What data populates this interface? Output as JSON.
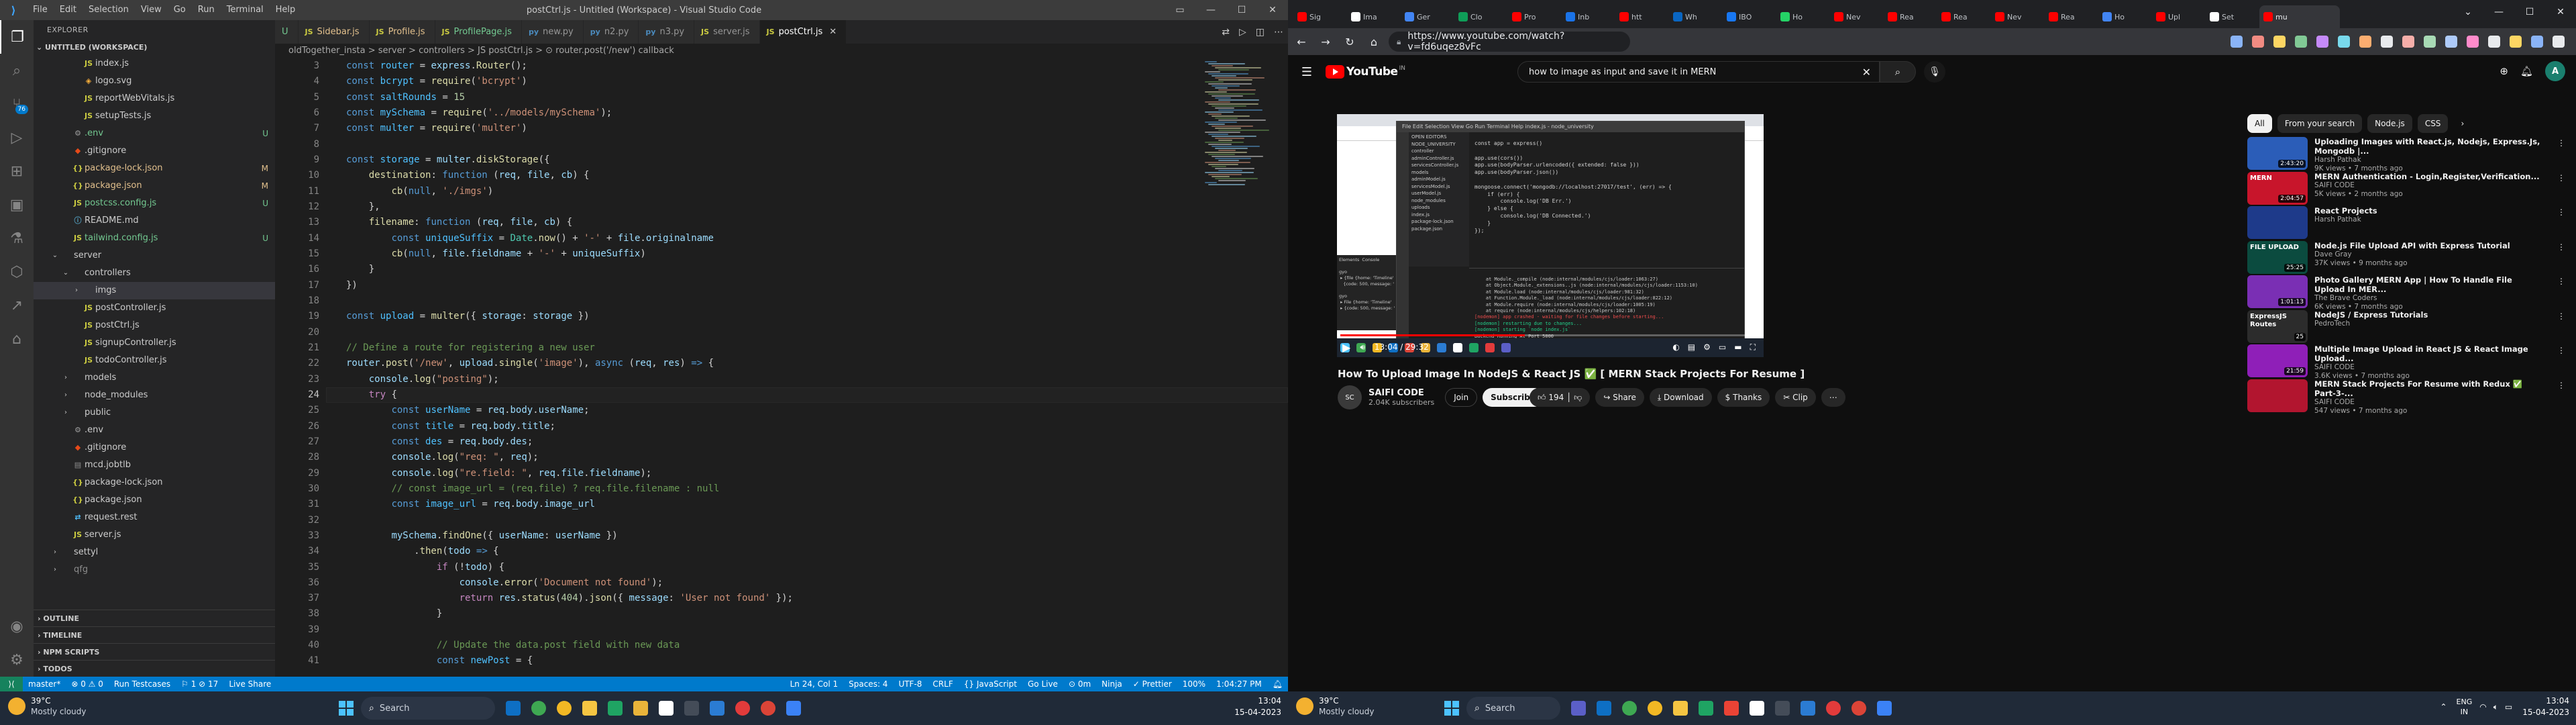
{
  "vscode": {
    "window_title": "postCtrl.js - Untitled (Workspace) - Visual Studio Code",
    "menu": [
      "File",
      "Edit",
      "Selection",
      "View",
      "Go",
      "Run",
      "Terminal",
      "Help"
    ],
    "explorer_title": "EXPLORER",
    "workspace": "UNTITLED (WORKSPACE)",
    "tree": [
      {
        "name": "index.js",
        "depth": 3,
        "kind": "js",
        "status": "",
        "cls": ""
      },
      {
        "name": "logo.svg",
        "depth": 3,
        "kind": "svg",
        "status": "",
        "cls": ""
      },
      {
        "name": "reportWebVitals.js",
        "depth": 3,
        "kind": "js",
        "status": "",
        "cls": ""
      },
      {
        "name": "setupTests.js",
        "depth": 3,
        "kind": "js",
        "status": "",
        "cls": ""
      },
      {
        "name": ".env",
        "depth": 2,
        "kind": "env",
        "status": "U",
        "cls": "untr"
      },
      {
        "name": ".gitignore",
        "depth": 2,
        "kind": "git",
        "status": "",
        "cls": ""
      },
      {
        "name": "package-lock.json",
        "depth": 2,
        "kind": "json",
        "status": "M",
        "cls": "mod"
      },
      {
        "name": "package.json",
        "depth": 2,
        "kind": "json",
        "status": "M",
        "cls": "mod"
      },
      {
        "name": "postcss.config.js",
        "depth": 2,
        "kind": "js",
        "status": "U",
        "cls": "untr"
      },
      {
        "name": "README.md",
        "depth": 2,
        "kind": "md",
        "status": "",
        "cls": ""
      },
      {
        "name": "tailwind.config.js",
        "depth": 2,
        "kind": "js",
        "status": "U",
        "cls": "untr"
      },
      {
        "name": "server",
        "depth": 1,
        "kind": "folder-open",
        "status": "",
        "cls": ""
      },
      {
        "name": "controllers",
        "depth": 2,
        "kind": "folder-open",
        "status": "",
        "cls": ""
      },
      {
        "name": "imgs",
        "depth": 3,
        "kind": "folder",
        "status": "",
        "cls": "sel"
      },
      {
        "name": "postController.js",
        "depth": 3,
        "kind": "js",
        "status": "",
        "cls": ""
      },
      {
        "name": "postCtrl.js",
        "depth": 3,
        "kind": "js",
        "status": "",
        "cls": ""
      },
      {
        "name": "signupController.js",
        "depth": 3,
        "kind": "js",
        "status": "",
        "cls": ""
      },
      {
        "name": "todoController.js",
        "depth": 3,
        "kind": "js",
        "status": "",
        "cls": ""
      },
      {
        "name": "models",
        "depth": 2,
        "kind": "folder",
        "status": "",
        "cls": ""
      },
      {
        "name": "node_modules",
        "depth": 2,
        "kind": "folder",
        "status": "",
        "cls": ""
      },
      {
        "name": "public",
        "depth": 2,
        "kind": "folder",
        "status": "",
        "cls": ""
      },
      {
        "name": ".env",
        "depth": 2,
        "kind": "env",
        "status": "",
        "cls": ""
      },
      {
        "name": ".gitignore",
        "depth": 2,
        "kind": "git",
        "status": "",
        "cls": ""
      },
      {
        "name": "mcd.jobtlb",
        "depth": 2,
        "kind": "file",
        "status": "",
        "cls": ""
      },
      {
        "name": "package-lock.json",
        "depth": 2,
        "kind": "json",
        "status": "",
        "cls": ""
      },
      {
        "name": "package.json",
        "depth": 2,
        "kind": "json",
        "status": "",
        "cls": ""
      },
      {
        "name": "request.rest",
        "depth": 2,
        "kind": "rest",
        "status": "",
        "cls": ""
      },
      {
        "name": "server.js",
        "depth": 2,
        "kind": "js",
        "status": "",
        "cls": ""
      },
      {
        "name": "settyl",
        "depth": 1,
        "kind": "folder",
        "status": "",
        "cls": ""
      },
      {
        "name": "qfg",
        "depth": 1,
        "kind": "folder",
        "status": "",
        "cls": "dim"
      }
    ],
    "bottom_sections": [
      "OUTLINE",
      "TIMELINE",
      "NPM SCRIPTS",
      "TODOS"
    ],
    "tabs": [
      {
        "label": "U",
        "icon": "",
        "active": false,
        "color": "#73c991"
      },
      {
        "label": "Sidebar.js",
        "icon": "JS",
        "active": false,
        "color": "#e2c08d"
      },
      {
        "label": "Profile.js",
        "icon": "JS",
        "active": false,
        "color": "#e2c08d"
      },
      {
        "label": "ProfilePage.js",
        "icon": "JS",
        "active": false,
        "color": "#73c991"
      },
      {
        "label": "new.py",
        "icon": "py",
        "active": false,
        "color": "#969696"
      },
      {
        "label": "n2.py",
        "icon": "py",
        "active": false,
        "color": "#969696"
      },
      {
        "label": "n3.py",
        "icon": "py",
        "active": false,
        "color": "#969696"
      },
      {
        "label": "server.js",
        "icon": "JS",
        "active": false,
        "color": "#969696"
      },
      {
        "label": "postCtrl.js",
        "icon": "JS",
        "active": true,
        "color": "#ffffff"
      }
    ],
    "breadcrumb": "oldTogether_insta  >  server  >  controllers  >  JS postCtrl.js  >  ⊙ router.post('/new') callback",
    "current_line": 24,
    "code": [
      {
        "n": 3,
        "h": "<span class=\"k\">const</span> <span class=\"cl4\">router</span> = <span class=\"v\">express</span>.<span class=\"f\">Router</span>();"
      },
      {
        "n": 4,
        "h": "<span class=\"k\">const</span> <span class=\"cl4\">bcrypt</span> = <span class=\"f\">require</span>(<span class=\"s\">'bcrypt'</span>)"
      },
      {
        "n": 5,
        "h": "<span class=\"k\">const</span> <span class=\"cl4\">saltRounds</span> = <span class=\"n\">15</span>"
      },
      {
        "n": 6,
        "h": "<span class=\"k\">const</span> <span class=\"cl4\">mySchema</span> = <span class=\"f\">require</span>(<span class=\"s\">'../models/mySchema'</span>);"
      },
      {
        "n": 7,
        "h": "<span class=\"k\">const</span> <span class=\"cl4\">multer</span> = <span class=\"f\">require</span>(<span class=\"s\">'multer'</span>)"
      },
      {
        "n": 8,
        "h": ""
      },
      {
        "n": 9,
        "h": "<span class=\"k\">const</span> <span class=\"cl4\">storage</span> = <span class=\"v\">multer</span>.<span class=\"f\">diskStorage</span>({"
      },
      {
        "n": 10,
        "h": "    <span class=\"f\">destination</span>: <span class=\"k\">function</span> (<span class=\"v\">req</span>, <span class=\"v\">file</span>, <span class=\"v\">cb</span>) {"
      },
      {
        "n": 11,
        "h": "        <span class=\"f\">cb</span>(<span class=\"k\">null</span>, <span class=\"s\">'./imgs'</span>)"
      },
      {
        "n": 12,
        "h": "    },"
      },
      {
        "n": 13,
        "h": "    <span class=\"f\">filename</span>: <span class=\"k\">function</span> (<span class=\"v\">req</span>, <span class=\"v\">file</span>, <span class=\"v\">cb</span>) {"
      },
      {
        "n": 14,
        "h": "        <span class=\"k\">const</span> <span class=\"cl4\">uniqueSuffix</span> = <span class=\"ty\">Date</span>.<span class=\"f\">now</span>() + <span class=\"s\">'-'</span> + <span class=\"v\">file</span>.<span class=\"v\">originalname</span>"
      },
      {
        "n": 15,
        "h": "        <span class=\"f\">cb</span>(<span class=\"k\">null</span>, <span class=\"v\">file</span>.<span class=\"v\">fieldname</span> + <span class=\"s\">'-'</span> + <span class=\"v\">uniqueSuffix</span>)"
      },
      {
        "n": 16,
        "h": "    }"
      },
      {
        "n": 17,
        "h": "})"
      },
      {
        "n": 18,
        "h": ""
      },
      {
        "n": 19,
        "h": "<span class=\"k\">const</span> <span class=\"cl4\">upload</span> = <span class=\"f\">multer</span>({ <span class=\"v\">storage</span>: <span class=\"v\">storage</span> })"
      },
      {
        "n": 20,
        "h": ""
      },
      {
        "n": 21,
        "h": "<span class=\"c\">// Define a route for registering a new user</span>"
      },
      {
        "n": 22,
        "h": "<span class=\"v\">router</span>.<span class=\"f\">post</span>(<span class=\"s\">'/new'</span>, <span class=\"v\">upload</span>.<span class=\"f\">single</span>(<span class=\"s\">'image'</span>), <span class=\"k\">async</span> (<span class=\"v\">req</span>, <span class=\"v\">res</span>) <span class=\"k\">=&gt;</span> {"
      },
      {
        "n": 23,
        "h": "    <span class=\"v\">console</span>.<span class=\"f\">log</span>(<span class=\"s\">\"posting\"</span>);"
      },
      {
        "n": 24,
        "h": "    <span class=\"kw\">try</span> {"
      },
      {
        "n": 25,
        "h": "        <span class=\"k\">const</span> <span class=\"cl4\">userName</span> = <span class=\"v\">req</span>.<span class=\"v\">body</span>.<span class=\"v\">userName</span>;"
      },
      {
        "n": 26,
        "h": "        <span class=\"k\">const</span> <span class=\"cl4\">title</span> = <span class=\"v\">req</span>.<span class=\"v\">body</span>.<span class=\"v\">title</span>;"
      },
      {
        "n": 27,
        "h": "        <span class=\"k\">const</span> <span class=\"cl4\">des</span> = <span class=\"v\">req</span>.<span class=\"v\">body</span>.<span class=\"v\">des</span>;"
      },
      {
        "n": 28,
        "h": "        <span class=\"v\">console</span>.<span class=\"f\">log</span>(<span class=\"s\">\"req: \"</span>, <span class=\"v\">req</span>);"
      },
      {
        "n": 29,
        "h": "        <span class=\"v\">console</span>.<span class=\"f\">log</span>(<span class=\"s\">\"re.field: \"</span>, <span class=\"v\">req</span>.<span class=\"v\">file</span>.<span class=\"v\">fieldname</span>);"
      },
      {
        "n": 30,
        "h": "        <span class=\"c\">// const image_url = (req.file) ? req.file.filename : null</span>"
      },
      {
        "n": 31,
        "h": "        <span class=\"k\">const</span> <span class=\"cl4\">image_url</span> = <span class=\"v\">req</span>.<span class=\"v\">body</span>.<span class=\"v\">image_url</span>"
      },
      {
        "n": 32,
        "h": ""
      },
      {
        "n": 33,
        "h": "        <span class=\"v\">mySchema</span>.<span class=\"f\">findOne</span>({ <span class=\"v\">userName</span>: <span class=\"v\">userName</span> })"
      },
      {
        "n": 34,
        "h": "            .<span class=\"f\">then</span>(<span class=\"v\">todo</span> <span class=\"k\">=&gt;</span> {"
      },
      {
        "n": 35,
        "h": "                <span class=\"kw\">if</span> (!<span class=\"v\">todo</span>) {"
      },
      {
        "n": 36,
        "h": "                    <span class=\"v\">console</span>.<span class=\"f\">error</span>(<span class=\"s\">'Document not found'</span>);"
      },
      {
        "n": 37,
        "h": "                    <span class=\"kw\">return</span> <span class=\"v\">res</span>.<span class=\"f\">status</span>(<span class=\"n\">404</span>).<span class=\"f\">json</span>({ <span class=\"v\">message</span>: <span class=\"s\">'User not found'</span> });"
      },
      {
        "n": 38,
        "h": "                }"
      },
      {
        "n": 39,
        "h": ""
      },
      {
        "n": 40,
        "h": "                <span class=\"c\">// Update the data.post field with new data</span>"
      },
      {
        "n": 41,
        "h": "                <span class=\"k\">const</span> <span class=\"cl4\">newPost</span> = {"
      }
    ],
    "status_left": [
      "master*",
      "⊗ 0  ⚠ 0",
      "Run Testcases",
      "⚐ 1  ⊘ 17",
      "Live Share"
    ],
    "status_right": [
      "Ln 24, Col 1",
      "Spaces: 4",
      "UTF-8",
      "CRLF",
      "{} JavaScript",
      "Go Live",
      "⊙ 0m",
      "Ninja",
      "✓ Prettier",
      "100%",
      "1:04:27 PM"
    ]
  },
  "left_taskbar": {
    "temp": "39°C",
    "condition": "Mostly cloudy",
    "search_placeholder": "Search",
    "time": "13:04",
    "date": "15-04-2023"
  },
  "chrome": {
    "active_tab_title": "mu",
    "url": "https://www.youtube.com/watch?v=fd6uqez8vFc",
    "tab_favicon_colors": [
      "#ff0000",
      "#ffffff",
      "#4285f4",
      "#0f9d58",
      "#ff0000",
      "#1a73e8",
      "#ff0000",
      "#0a66c2",
      "#1877f2",
      "#25d366",
      "#ff0000",
      "#ff0000",
      "#ff0000",
      "#ff0000",
      "#ff0000",
      "#4285f4",
      "#ff0000",
      "#ffffff",
      "#ff0000",
      "#ff0000",
      "#ffffff",
      "#ff0000"
    ],
    "tab_labels": [
      "Sig",
      "Ima",
      "Ger",
      "Clo",
      "Pro",
      "Inb",
      "htt",
      "Wh",
      "IBO",
      "Ho",
      "Nev",
      "Rea",
      "Rea",
      "Nev",
      "Rea",
      "Ho",
      "Upl",
      "Set",
      "mu"
    ]
  },
  "youtube": {
    "logo_text": "YouTube",
    "country": "IN",
    "search_value": "how to image as input and save it in MERN",
    "video_title": "How To Upload Image In NodeJS & React JS ✅ [ MERN Stack Projects For Resume ]",
    "channel": "SAIFI CODE",
    "subscribers": "2.04K subscribers",
    "join": "Join",
    "subscribe": "Subscribe",
    "likes": "194",
    "share": "Share",
    "download": "Download",
    "thanks": "Thanks",
    "clip": "Clip",
    "time": "13:04 / 29:32",
    "progress": 0.44,
    "chips": [
      "All",
      "From your search",
      "Node.js",
      "CSS"
    ],
    "related": [
      {
        "title": "Uploading Images with React.js, Nodejs, Express.Js, Mongodb |...",
        "channel": "Harsh Pathak",
        "meta": "9K views • 7 months ago",
        "duration": "2:43:20",
        "thumb": "#2b5db8",
        "cap": ""
      },
      {
        "title": "MERN Authentication - Login,Register,Verification...",
        "channel": "SAIFI CODE",
        "meta": "5K views • 2 months ago",
        "duration": "2:04:57",
        "thumb": "#c8152b",
        "cap": "MERN"
      },
      {
        "title": "React Projects",
        "channel": "Harsh Pathak",
        "meta": "",
        "duration": "",
        "thumb": "#1e3a8a",
        "cap": ""
      },
      {
        "title": "Node.js File Upload API with Express Tutorial",
        "channel": "Dave Gray",
        "meta": "37K views • 9 months ago",
        "duration": "25:25",
        "thumb": "#0b4b3f",
        "cap": "FILE UPLOAD"
      },
      {
        "title": "Photo Gallery MERN App | How To Handle File Upload In MER...",
        "channel": "The Brave Coders",
        "meta": "6K views • 7 months ago",
        "duration": "1:01:13",
        "thumb": "#7a2fb4",
        "cap": ""
      },
      {
        "title": "NodeJS / Express Tutorials",
        "channel": "PedroTech",
        "meta": "",
        "duration": "25",
        "thumb": "#2c2c2c",
        "cap": "ExpressJS Routes"
      },
      {
        "title": "Multiple Image Upload in React JS & React Image Upload...",
        "channel": "SAIFI CODE",
        "meta": "3.6K views • 7 months ago",
        "duration": "21:59",
        "thumb": "#8f1fb8",
        "cap": ""
      },
      {
        "title": "MERN Stack Projects For Resume with Redux ✅ Part-3-...",
        "channel": "SAIFI CODE",
        "meta": "547 views • 7 months ago",
        "duration": "",
        "thumb": "#b2152f",
        "cap": ""
      }
    ],
    "inner_code": [
      "const app = express()",
      "",
      "app.use(cors())",
      "app.use(bodyParser.urlencoded({ extended: false }))",
      "app.use(bodyParser.json())",
      "",
      "mongoose.connect('mongodb://localhost:27017/test', (err) => {",
      "    if (err) {",
      "        console.log('DB Err.')",
      "    } else {",
      "        console.log('DB Connected.')",
      "    }",
      "});"
    ],
    "inner_terminal": [
      "    at Module._compile (node:internal/modules/cjs/loader:1063:27)",
      "    at Object.Module._extensions..js (node:internal/modules/cjs/loader:1153:10)",
      "    at Module.load (node:internal/modules/cjs/loader:981:32)",
      "    at Function.Module._load (node:internal/modules/cjs/loader:822:12)",
      "    at Module.require (node:internal/modules/cjs/loader:1005:19)",
      "    at require (node:internal/modules/cjs/helpers:102:18)",
      "[nodemon] app crashed - waiting for file changes before starting...",
      "[nodemon] restarting due to changes...",
      "[nodemon] starting `node index.js`",
      "Backend Running At Port 5000",
      "DB Connected."
    ],
    "inner_explorer": [
      "OPEN EDITORS",
      "NODE_UNIVERSITY",
      "  controller",
      "    adminController.js",
      "    servicesController.js",
      "  models",
      "    adminModel.js",
      "    servicesModel.js",
      "    userModel.js",
      "  node_modules",
      "  uploads",
      "  index.js",
      "  package-lock.json",
      "  package.json"
    ]
  },
  "right_taskbar": {
    "temp": "39°C",
    "condition": "Mostly cloudy",
    "search_placeholder": "Search",
    "lang1": "ENG",
    "lang2": "IN",
    "time": "13:04",
    "date": "15-04-2023"
  }
}
